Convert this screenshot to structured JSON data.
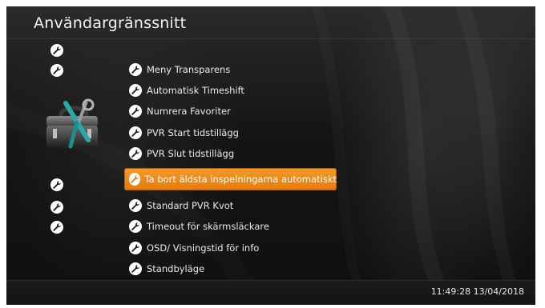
{
  "header": {
    "title": "Användargränssnitt"
  },
  "menu": {
    "items": [
      {
        "label": "Meny Transparens"
      },
      {
        "label": "Automatisk Timeshift"
      },
      {
        "label": "Numrera Favoriter"
      },
      {
        "label": "PVR Start tidstillägg"
      },
      {
        "label": "PVR Slut tidstillägg"
      },
      {
        "label": "Ta bort äldsta inspelningarna automatiskt",
        "selected": true
      },
      {
        "label": "Standard PVR Kvot"
      },
      {
        "label": "Timeout för skärmsläckare"
      },
      {
        "label": "OSD/ Visningstid för info"
      },
      {
        "label": "Standbyläge"
      }
    ]
  },
  "footer": {
    "clock": "11:49:28 13/04/2018"
  },
  "colors": {
    "accent": "#e47b0d",
    "background": "#141414",
    "text": "#eaeaea"
  },
  "icons": {
    "item_icon": "wrench-icon",
    "toolbox": "toolbox-icon"
  }
}
